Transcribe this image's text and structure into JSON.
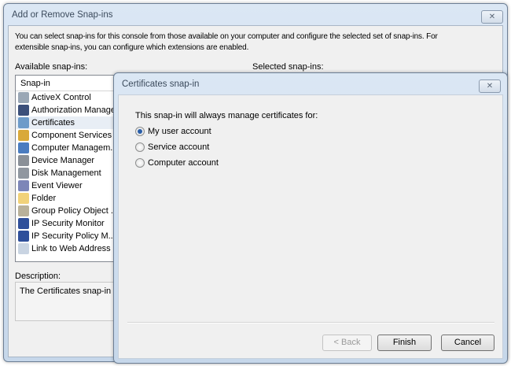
{
  "main": {
    "title": "Add or Remove Snap-ins",
    "close": "✕",
    "intro_line1": "You can select snap-ins for this console from those available on your computer and configure the selected set of snap-ins. For",
    "intro_line2": "extensible snap-ins, you can configure which extensions are enabled.",
    "available_label": "Available snap-ins:",
    "selected_label": "Selected snap-ins:",
    "column_header": "Snap-in",
    "items": [
      {
        "label": "ActiveX Control",
        "color": "#9aa7b5"
      },
      {
        "label": "Authorization Manager",
        "color": "#3b4f7a"
      },
      {
        "label": "Certificates",
        "color": "#6d9bc9"
      },
      {
        "label": "Component Services",
        "color": "#d9a93a"
      },
      {
        "label": "Computer Managem...",
        "color": "#4a7cc0"
      },
      {
        "label": "Device Manager",
        "color": "#8a9098"
      },
      {
        "label": "Disk Management",
        "color": "#9097a0"
      },
      {
        "label": "Event Viewer",
        "color": "#7d86b8"
      },
      {
        "label": "Folder",
        "color": "#f1d27a"
      },
      {
        "label": "Group Policy Object ...",
        "color": "#b9b19a"
      },
      {
        "label": "IP Security Monitor",
        "color": "#2f4f9a"
      },
      {
        "label": "IP Security Policy M...",
        "color": "#2f4f9a"
      },
      {
        "label": "Link to Web Address",
        "color": "#c9d4e2"
      }
    ],
    "description_label": "Description:",
    "description_text": "The Certificates snap-in all"
  },
  "dialog": {
    "title": "Certificates snap-in",
    "close": "✕",
    "prompt": "This snap-in will always manage certificates for:",
    "options": [
      {
        "label": "My user account",
        "selected": true
      },
      {
        "label": "Service account",
        "selected": false
      },
      {
        "label": "Computer account",
        "selected": false
      }
    ],
    "back": "< Back",
    "finish": "Finish",
    "cancel": "Cancel"
  }
}
